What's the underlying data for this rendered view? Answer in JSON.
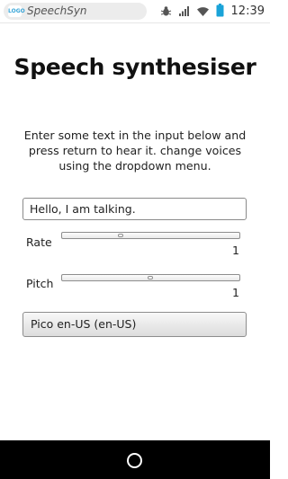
{
  "status_bar": {
    "app_name": "SpeechSyn",
    "app_logo_text": "LOGO",
    "time": "12:39",
    "icons": [
      "bug-icon",
      "signal-icon",
      "wifi-icon",
      "battery-icon"
    ]
  },
  "main": {
    "title": "Speech synthesiser",
    "instructions": "Enter some text in the input below and press return to hear it. change voices using the dropdown menu.",
    "text_input": {
      "value": "Hello, I am talking."
    },
    "rate": {
      "label": "Rate",
      "value": "1",
      "level": 0.33
    },
    "pitch": {
      "label": "Pitch",
      "value": "1",
      "level": 0.5
    },
    "voice_select": {
      "selected": "Pico en-US (en-US)"
    }
  },
  "colors": {
    "status_text": "#555555",
    "nav_bar": "#000000",
    "battery": "#1aa3d8"
  }
}
